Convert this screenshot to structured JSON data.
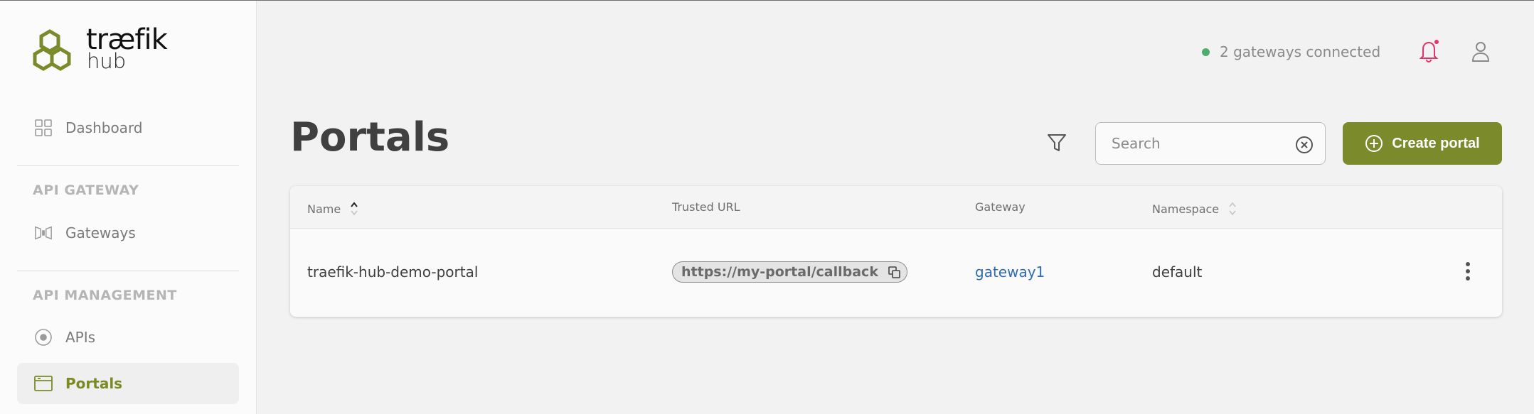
{
  "brand": {
    "name": "træfik",
    "sub": "hub",
    "accent": "#7b8a2b"
  },
  "sidebar": {
    "dashboard": {
      "label": "Dashboard",
      "icon": "grid-icon"
    },
    "sections": [
      {
        "title": "API GATEWAY",
        "items": [
          {
            "label": "Gateways",
            "icon": "gateway-icon"
          }
        ]
      },
      {
        "title": "API MANAGEMENT",
        "items": [
          {
            "label": "APIs",
            "icon": "api-icon"
          },
          {
            "label": "Portals",
            "icon": "portal-icon",
            "active": true
          }
        ]
      }
    ]
  },
  "topbar": {
    "status": "2 gateways connected",
    "status_color": "#4cae6e",
    "notification_color": "#e8336a"
  },
  "page": {
    "title": "Portals",
    "search": {
      "placeholder": "Search",
      "value": ""
    },
    "create_label": "Create portal"
  },
  "table": {
    "columns": [
      "Name",
      "Trusted URL",
      "Gateway",
      "Namespace"
    ],
    "rows": [
      {
        "name": "traefik-hub-demo-portal",
        "trusted_url": "https://my-portal/callback",
        "gateway": "gateway1",
        "namespace": "default"
      }
    ]
  }
}
